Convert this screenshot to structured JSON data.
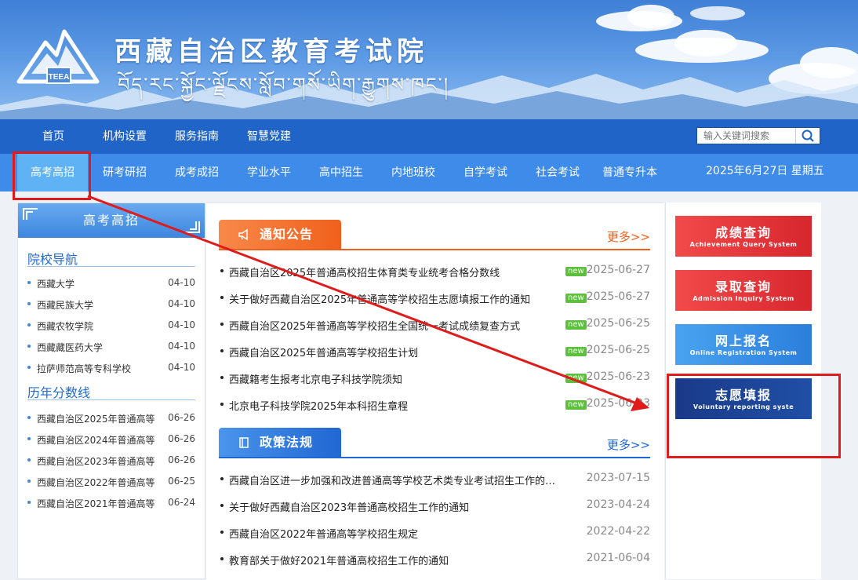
{
  "site": {
    "title": "西藏自治区教育考试院",
    "subtitle": "བོད་རང་སྐྱོང་ལྗོངས་སློབ་གསོ་ཡིག་རྒྱུགས་ཁང་།",
    "logo_text": "TEEA"
  },
  "nav_top": [
    {
      "label": "首页"
    },
    {
      "label": "机构设置"
    },
    {
      "label": "服务指南"
    },
    {
      "label": "智慧党建"
    }
  ],
  "search": {
    "placeholder": "输入关键词搜索",
    "icon": "search-icon"
  },
  "nav_main": [
    {
      "label": "高考高招",
      "active": true
    },
    {
      "label": "研考研招"
    },
    {
      "label": "成考成招"
    },
    {
      "label": "学业水平"
    },
    {
      "label": "高中招生"
    },
    {
      "label": "内地班校"
    },
    {
      "label": "自学考试"
    },
    {
      "label": "社会考试"
    },
    {
      "label": "普通专升本"
    }
  ],
  "date_text": "2025年6月27日 星期五",
  "sidebar": {
    "header": "高考高招",
    "sections": [
      {
        "title": "院校导航",
        "items": [
          {
            "text": "西藏大学",
            "date": "04-10"
          },
          {
            "text": "西藏民族大学",
            "date": "04-10"
          },
          {
            "text": "西藏农牧学院",
            "date": "04-10"
          },
          {
            "text": "西藏藏医药大学",
            "date": "04-10"
          },
          {
            "text": "拉萨师范高等专科学校",
            "date": "04-10"
          }
        ]
      },
      {
        "title": "历年分数线",
        "items": [
          {
            "text": "西藏自治区2025年普通高等...",
            "date": "06-26"
          },
          {
            "text": "西藏自治区2024年普通高等...",
            "date": "06-26"
          },
          {
            "text": "西藏自治区2023年普通高等...",
            "date": "06-26"
          },
          {
            "text": "西藏自治区2022年普通高等...",
            "date": "06-25"
          },
          {
            "text": "西藏自治区2021年普通高等...",
            "date": "06-24"
          }
        ]
      }
    ]
  },
  "notices": {
    "title": "通知公告",
    "more": "更多>>",
    "accent": "#f26a1f",
    "items": [
      {
        "text": "西藏自治区2025年普通高校招生体育类专业统考合格分数线",
        "badge": "new",
        "date": "2025-06-27"
      },
      {
        "text": "关于做好西藏自治区2025年普通高等学校招生志愿填报工作的通知",
        "badge": "new",
        "date": "2025-06-27"
      },
      {
        "text": "西藏自治区2025年普通高等学校招生全国统一考试成绩复查方式",
        "badge": "new",
        "date": "2025-06-25"
      },
      {
        "text": "西藏自治区2025年普通高等学校招生计划",
        "badge": "new",
        "date": "2025-06-25"
      },
      {
        "text": "西藏籍考生报考北京电子科技学院须知",
        "badge": "new",
        "date": "2025-06-23"
      },
      {
        "text": "北京电子科技学院2025年本科招生章程",
        "badge": "new",
        "date": "2025-06-23"
      }
    ]
  },
  "policies": {
    "title": "政策法规",
    "more": "更多>>",
    "accent": "#2a73d8",
    "items": [
      {
        "text": "西藏自治区进一步加强和改进普通高等学校艺术类专业考试招生工作的实施意见",
        "date": "2023-07-15"
      },
      {
        "text": "关于做好西藏自治区2023年普通高校招生工作的通知",
        "date": "2023-04-24"
      },
      {
        "text": "西藏自治区2022年普通高等学校招生规定",
        "date": "2022-04-22"
      },
      {
        "text": "教育部关于做好2021年普通高校招生工作的通知",
        "date": "2021-06-04"
      }
    ]
  },
  "quick_links": [
    {
      "title": "成绩查询",
      "subtitle": "Achievement Query System",
      "color": "#e8353a"
    },
    {
      "title": "录取查询",
      "subtitle": "Admission Inquiry System",
      "color": "#e8353a"
    },
    {
      "title": "网上报名",
      "subtitle": "Online Registration System",
      "color": "#3b93e6"
    },
    {
      "title": "志愿填报",
      "subtitle": "Voluntary reporting syste",
      "color": "#1b3f8f"
    }
  ],
  "annotation": {
    "color": "#e01b1b"
  }
}
